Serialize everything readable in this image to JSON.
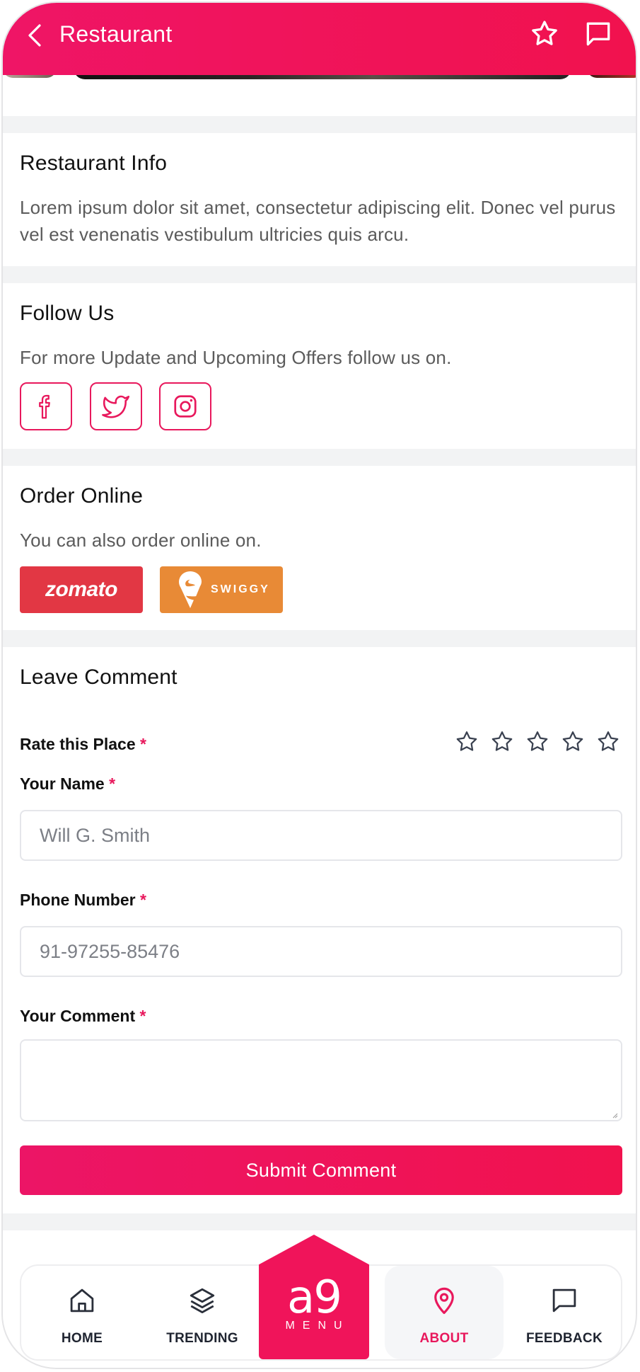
{
  "header": {
    "title": "Restaurant",
    "back_icon": "chevron-left-icon",
    "favorite_icon": "star-icon",
    "chat_icon": "chat-bubble-icon",
    "color": "#ef1566"
  },
  "info": {
    "title": "Restaurant Info",
    "text": "Lorem ipsum dolor sit amet, consectetur adipiscing elit. Donec vel purus vel est venenatis vestibulum ultricies quis arcu."
  },
  "follow": {
    "title": "Follow Us",
    "text": "For more Update and Upcoming Offers follow us on.",
    "networks": [
      "facebook-icon",
      "twitter-icon",
      "instagram-icon"
    ]
  },
  "order": {
    "title": "Order Online",
    "text": "You can also order online on.",
    "zomato_label": "zomato",
    "swiggy_label": "SWIGGY"
  },
  "comment": {
    "title": "Leave Comment",
    "rate_label": "Rate this Place",
    "name_label": "Your Name",
    "name_placeholder": "Will G. Smith",
    "phone_label": "Phone Number",
    "phone_placeholder": "91-97255-85476",
    "comment_label": "Your Comment",
    "required_mark": "*",
    "rating": 0,
    "rating_max": 5,
    "submit_label": "Submit Comment"
  },
  "nav": {
    "home": "HOME",
    "trending": "TRENDING",
    "about": "ABOUT",
    "feedback": "FEEDBACK",
    "logo_top": "a9",
    "logo_bottom": "MENU",
    "active": "about"
  },
  "colors": {
    "accent": "#e8185c",
    "zomato": "#e23744",
    "swiggy": "#e88a36"
  }
}
